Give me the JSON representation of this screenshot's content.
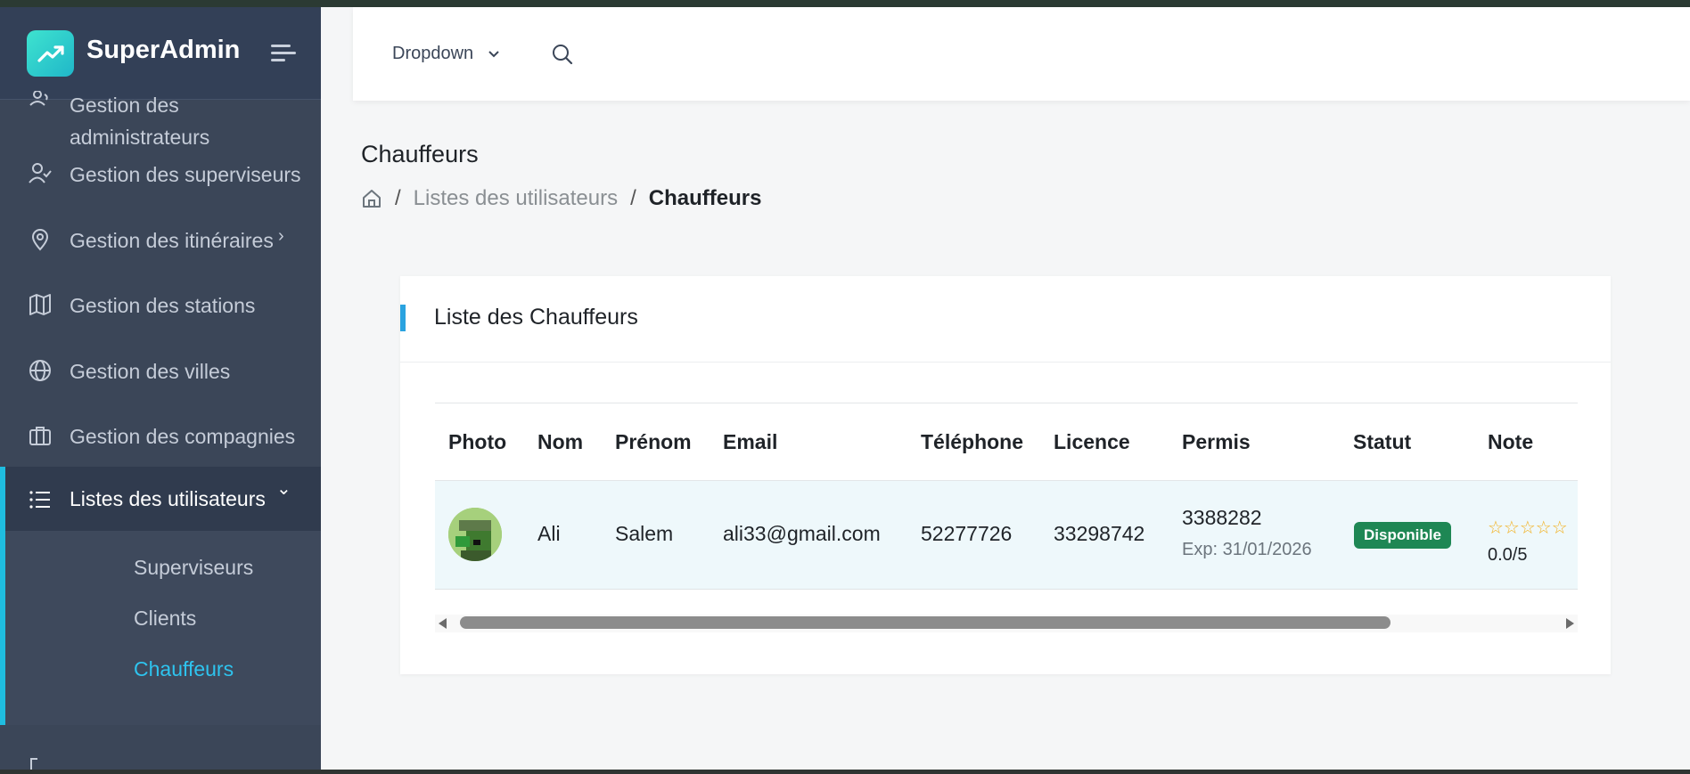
{
  "colors": {
    "sidebar_bg": "#3b4658",
    "accent": "#1fbde0",
    "active_sub": "#2ec4ef",
    "badge_success": "#1e8754",
    "star": "#f2b01e"
  },
  "sidebar": {
    "brand": "SuperAdmin",
    "items": [
      {
        "label": "Gestion des\nadministrateurs",
        "icon": "users-icon"
      },
      {
        "label": "Gestion des superviseurs",
        "icon": "user-check-icon"
      },
      {
        "label": "Gestion des itinéraires",
        "icon": "map-pin-icon",
        "chevron": "›"
      },
      {
        "label": "Gestion des stations",
        "icon": "map-icon"
      },
      {
        "label": "Gestion des villes",
        "icon": "globe-icon"
      },
      {
        "label": "Gestion des compagnies",
        "icon": "briefcase-icon"
      },
      {
        "label": "Listes des utilisateurs",
        "icon": "list-icon",
        "chevron": "⌄",
        "active": true
      }
    ],
    "submenu": [
      {
        "label": "Superviseurs"
      },
      {
        "label": "Clients"
      },
      {
        "label": "Chauffeurs",
        "active": true
      }
    ]
  },
  "header": {
    "dropdown_label": "Dropdown"
  },
  "page": {
    "title": "Chauffeurs",
    "breadcrumb": [
      "Listes des utilisateurs",
      "Chauffeurs"
    ]
  },
  "card": {
    "title": "Liste des Chauffeurs",
    "columns": [
      "Photo",
      "Nom",
      "Prénom",
      "Email",
      "Téléphone",
      "Licence",
      "Permis",
      "Statut",
      "Note"
    ],
    "rows": [
      {
        "nom": "Ali",
        "prenom": "Salem",
        "email": "ali33@gmail.com",
        "telephone": "52277726",
        "licence": "33298742",
        "permis": "3388282",
        "permis_exp": "Exp: 31/01/2026",
        "statut": "Disponible",
        "stars": "☆☆☆☆☆",
        "note": "0.0/5",
        "rating": 0
      }
    ]
  }
}
